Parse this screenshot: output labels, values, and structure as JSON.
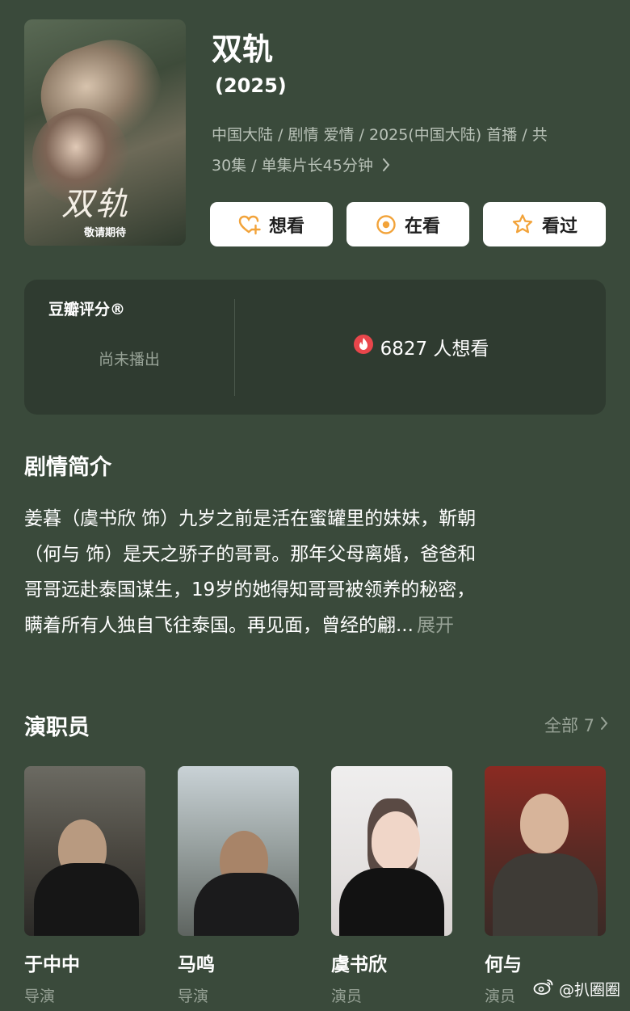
{
  "header": {
    "poster": {
      "title_art": "双轨",
      "tagline": "敬请期待"
    },
    "title": "双轨",
    "year": "(2025)",
    "meta_line1": "中国大陆 / 剧情 爱情 / 2025(中国大陆) 首播 / 共",
    "meta_line2": "30集 / 单集片长45分钟",
    "meta_chevron_icon": "chevron-right-icon"
  },
  "actions": [
    {
      "label": "想看",
      "icon": "heart-plus-icon"
    },
    {
      "label": "在看",
      "icon": "target-icon"
    },
    {
      "label": "看过",
      "icon": "star-icon"
    }
  ],
  "rating": {
    "label": "豆瓣评分®",
    "status": "尚未播出",
    "wish_count": "6827 人想看",
    "wish_icon": "flame-icon"
  },
  "synopsis": {
    "title": "剧情简介",
    "lines": [
      "姜暮（虞书欣 饰）九岁之前是活在蜜罐里的妹妹，靳朝",
      "（何与 饰）是天之骄子的哥哥。那年父母离婚，爸爸和",
      "哥哥远赴泰国谋生，19岁的她得知哥哥被领养的秘密，",
      "瞒着所有人独自飞往泰国。再见面，曾经的翩..."
    ],
    "expand_label": "展开"
  },
  "cast": {
    "title": "演职员",
    "see_all": "全部 7",
    "members": [
      {
        "name": "于中中",
        "role": "导演"
      },
      {
        "name": "马鸣",
        "role": "导演"
      },
      {
        "name": "虞书欣",
        "role": "演员"
      },
      {
        "name": "何与",
        "role": "演员"
      }
    ]
  },
  "watermark": {
    "text": "@扒圈圈",
    "icon": "weibo-icon"
  },
  "colors": {
    "background": "#3a4a3b",
    "card": "#2f3b30",
    "muted_text": "#98a397",
    "flame": "#e9464b"
  }
}
